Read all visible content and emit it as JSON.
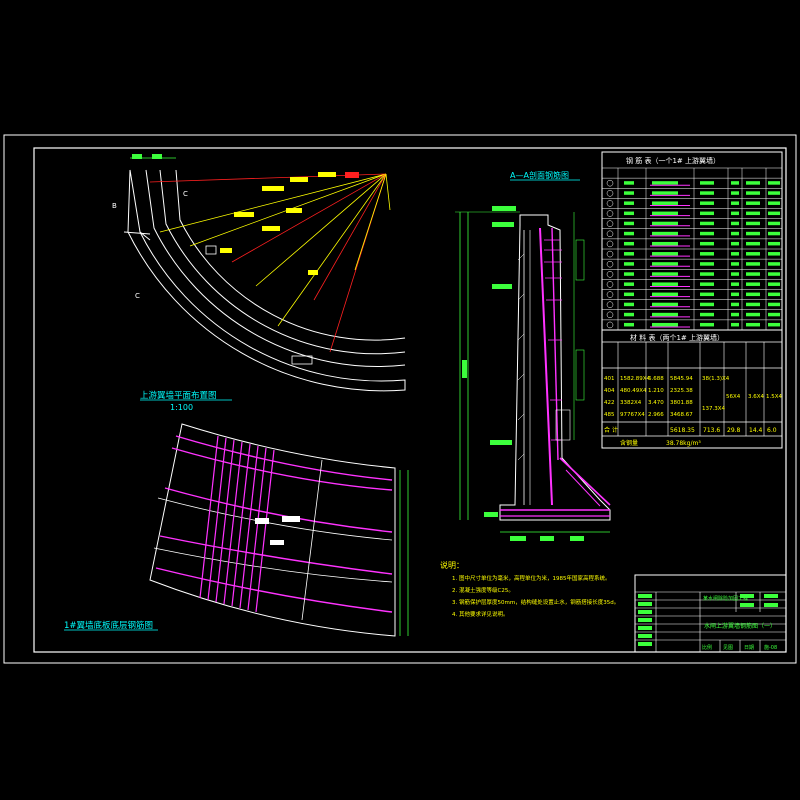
{
  "plan": {
    "title": "上游翼墙平面布置图",
    "scale": "1:100",
    "sec_c": "C",
    "sec_b": "B",
    "sec_c2": "C"
  },
  "section": {
    "title": "A—A剖面钢筋图"
  },
  "floor": {
    "title": "1#翼墙底板底层钢筋图"
  },
  "rebar_table": {
    "title": "钢 筋 表（一个1# 上游翼墙）",
    "row_count": 15
  },
  "material_table": {
    "title": "材 料 表（两个1# 上游翼墙）",
    "rows": [
      [
        "401",
        "1582.89X4",
        "6.688",
        "5845.94",
        "",
        "",
        "",
        ""
      ],
      [
        "404",
        "480.49X4",
        "1.210",
        "2325.38",
        "",
        "",
        "",
        ""
      ],
      [
        "422",
        "3382X4",
        "3.470",
        "3801.88",
        "",
        "",
        "",
        ""
      ],
      [
        "485",
        "97767X4",
        "2.966",
        "3468.67",
        "",
        "",
        "",
        ""
      ]
    ],
    "total_label": "合    计",
    "total_values": [
      "5618.35",
      "713.6",
      "29.8",
      "14.4",
      "6.0"
    ],
    "mid_values": [
      "38(1.3)X4",
      "137.3X4",
      "56X4",
      "3.6X4",
      "1.5X4"
    ],
    "unit_label": "含钢量",
    "unit_value": "38.78kg/m³"
  },
  "notes": {
    "heading": "说明：",
    "lines": [
      "1. 图中尺寸单位为毫米，高程单位为米，1985年国家高程系统。",
      "2. 混凝土强度等级C25。",
      "3. 钢筋保护层厚度50mm，结构缝处设置止水，钢筋搭接长度35d。",
      "4. 其他要求详见说明。"
    ]
  },
  "title_block": {
    "project": "某水闸除险加固工程",
    "drawing_title": "水闸上游翼墙钢筋图（一）",
    "scale_label": "比例",
    "scale_value": "见图",
    "date_label": "日期",
    "drawing_no": "施-08"
  },
  "colors": {
    "frame": "#ffffff",
    "green": "#3cff3c",
    "yellow": "#ffff00",
    "magenta": "#ff33ff",
    "red": "#ff2020",
    "cyan": "#00ffff"
  }
}
